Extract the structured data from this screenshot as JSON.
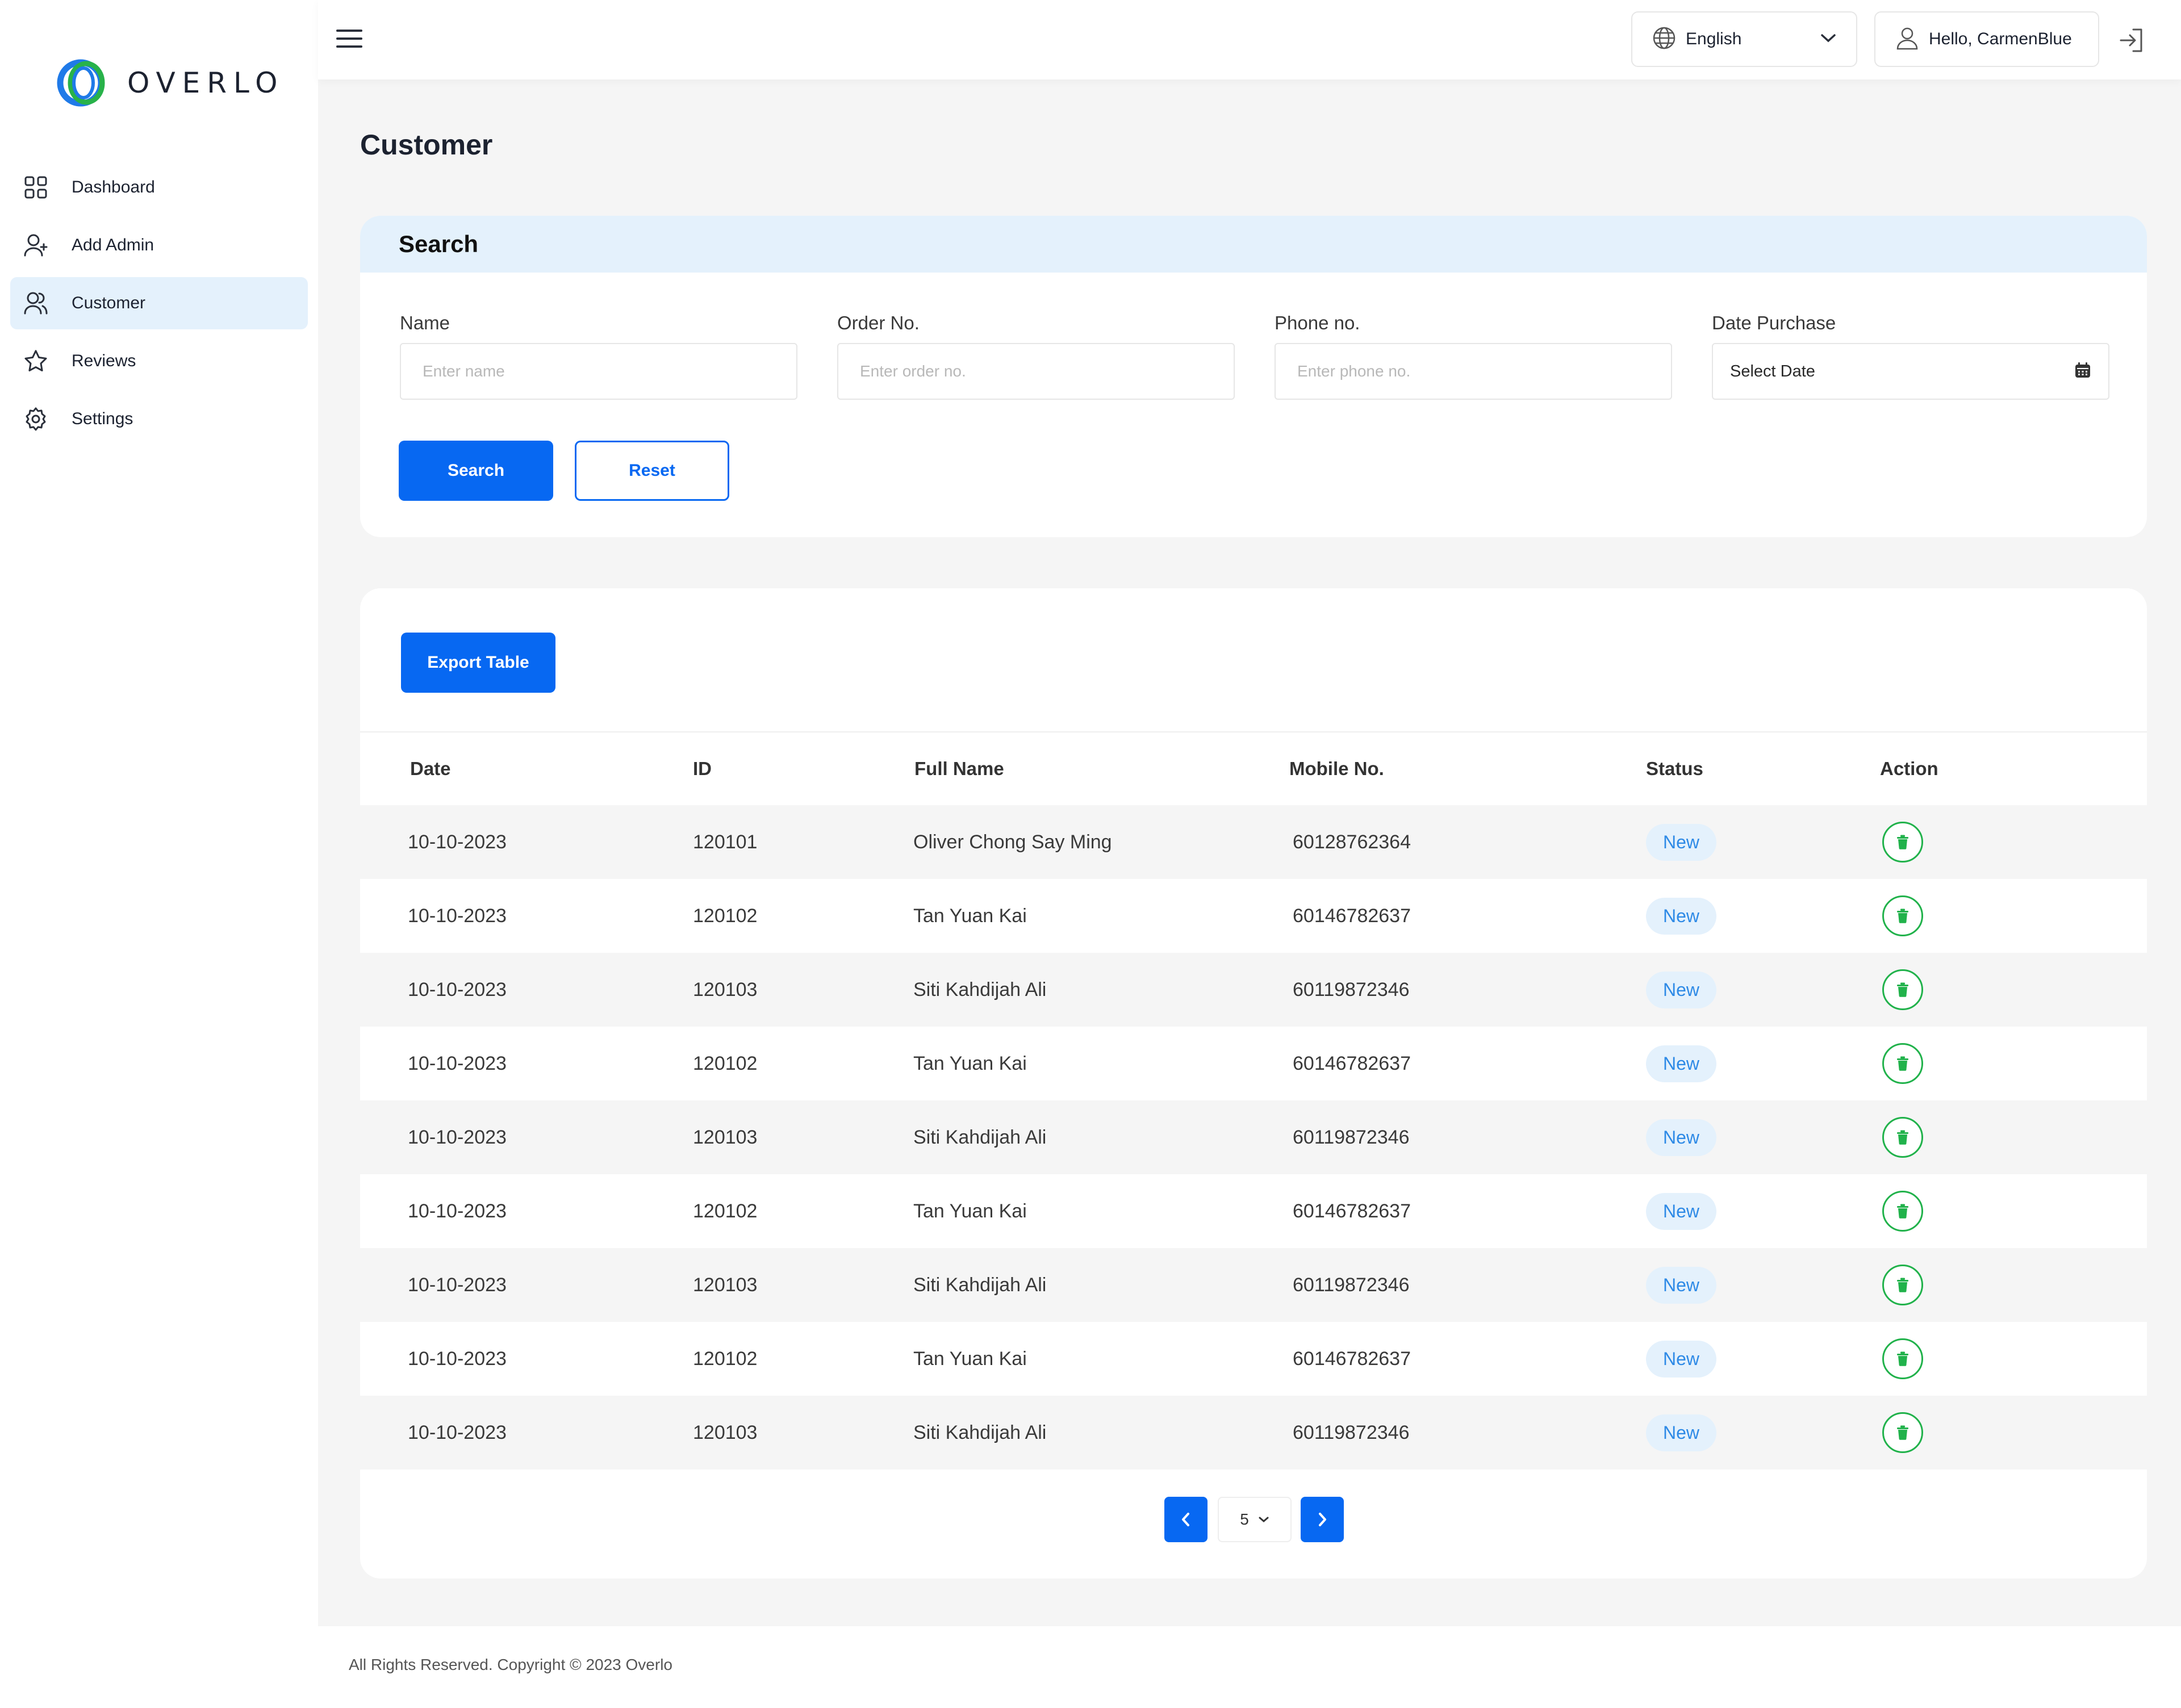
{
  "app": {
    "logo_text": "OVERLO"
  },
  "sidebar": {
    "items": [
      {
        "label": "Dashboard",
        "icon": "grid-icon"
      },
      {
        "label": "Add Admin",
        "icon": "user-plus-icon"
      },
      {
        "label": "Customer",
        "icon": "users-icon",
        "active": true
      },
      {
        "label": "Reviews",
        "icon": "star-icon"
      },
      {
        "label": "Settings",
        "icon": "gear-icon"
      }
    ]
  },
  "header": {
    "language": "English",
    "greeting": "Hello, CarmenBlue"
  },
  "page": {
    "title": "Customer"
  },
  "search": {
    "title": "Search",
    "fields": {
      "name": {
        "label": "Name",
        "placeholder": "Enter name"
      },
      "order": {
        "label": "Order No.",
        "placeholder": "Enter order no."
      },
      "phone": {
        "label": "Phone no.",
        "placeholder": "Enter phone no."
      },
      "date": {
        "label": "Date Purchase",
        "value": "Select Date"
      }
    },
    "search_label": "Search",
    "reset_label": "Reset"
  },
  "table": {
    "export_label": "Export Table",
    "columns": [
      "Date",
      "ID",
      "Full Name",
      "Mobile No.",
      "Status",
      "Action"
    ],
    "rows": [
      {
        "date": "10-10-2023",
        "id": "120101",
        "name": "Oliver Chong Say Ming",
        "mobile": "60128762364",
        "status": "New"
      },
      {
        "date": "10-10-2023",
        "id": "120102",
        "name": "Tan Yuan Kai",
        "mobile": "60146782637",
        "status": "New"
      },
      {
        "date": "10-10-2023",
        "id": "120103",
        "name": "Siti Kahdijah Ali",
        "mobile": "60119872346",
        "status": "New"
      },
      {
        "date": "10-10-2023",
        "id": "120102",
        "name": "Tan Yuan Kai",
        "mobile": "60146782637",
        "status": "New"
      },
      {
        "date": "10-10-2023",
        "id": "120103",
        "name": "Siti Kahdijah Ali",
        "mobile": "60119872346",
        "status": "New"
      },
      {
        "date": "10-10-2023",
        "id": "120102",
        "name": "Tan Yuan Kai",
        "mobile": "60146782637",
        "status": "New"
      },
      {
        "date": "10-10-2023",
        "id": "120103",
        "name": "Siti Kahdijah Ali",
        "mobile": "60119872346",
        "status": "New"
      },
      {
        "date": "10-10-2023",
        "id": "120102",
        "name": "Tan Yuan Kai",
        "mobile": "60146782637",
        "status": "New"
      },
      {
        "date": "10-10-2023",
        "id": "120103",
        "name": "Siti Kahdijah Ali",
        "mobile": "60119872346",
        "status": "New"
      }
    ]
  },
  "pagination": {
    "page_size": "5"
  },
  "footer": {
    "text": "All Rights Reserved. Copyright © 2023 Overlo"
  },
  "colors": {
    "primary": "#0768f2",
    "active_bg": "#e4f1fc",
    "badge_text": "#2e8ae6",
    "delete": "#21b24b"
  }
}
